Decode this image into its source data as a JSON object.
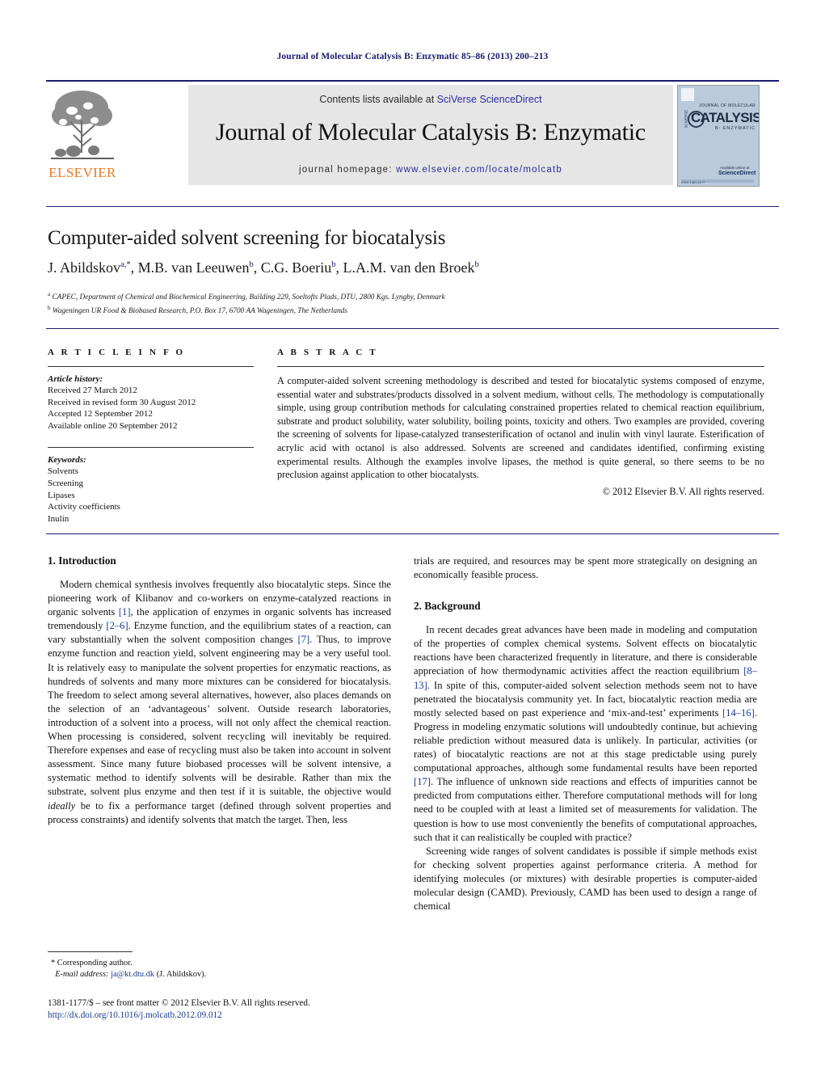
{
  "running_head": "Journal of Molecular Catalysis B: Enzymatic 85–86 (2013) 200–213",
  "masthead": {
    "publisher_name": "ELSEVIER",
    "contents_prefix": "Contents lists available at ",
    "contents_link": "SciVerse ScienceDirect",
    "journal_name": "Journal of Molecular Catalysis B: Enzymatic",
    "homepage_prefix": "journal homepage: ",
    "homepage_url": "www.elsevier.com/locate/molcatb",
    "cover": {
      "top_text": "JOURNAL OF MOLECULAR",
      "main_text": "CATALYSIS",
      "sub_text": "B: ENZYMATIC",
      "side_text": "SCIVERSE",
      "bottom_label": "Available online at",
      "bottom_brand": "ScienceDirect",
      "foot_text": "ISSN 1381-1177",
      "background_color": "#b9cadc"
    }
  },
  "article": {
    "title": "Computer-aided solvent screening for biocatalysis",
    "authors_html": "J. Abildskov<sup>a,*</sup>, M.B. van Leeuwen<sup>b</sup>, C.G. Boeriu<sup>b</sup>, L.A.M. van den Broek<sup>b</sup>",
    "affiliation_a": "CAPEC, Department of Chemical and Biochemical Engineering, Building 229, Soeltofts Plads, DTU, 2800 Kgs. Lyngby, Denmark",
    "affiliation_b": "Wageningen UR Food & Biobased Research, P.O. Box 17, 6700 AA Wageningen, The Netherlands"
  },
  "info": {
    "heading": "A R T I C L E    I N F O",
    "history_title": "Article history:",
    "history": [
      "Received 27 March 2012",
      "Received in revised form 30 August 2012",
      "Accepted 12 September 2012",
      "Available online 20 September 2012"
    ],
    "keywords_title": "Keywords:",
    "keywords": [
      "Solvents",
      "Screening",
      "Lipases",
      "Activity coefficients",
      "Inulin"
    ]
  },
  "abstract": {
    "heading": "A B S T R A C T",
    "text": "A computer-aided solvent screening methodology is described and tested for biocatalytic systems composed of enzyme, essential water and substrates/products dissolved in a solvent medium, without cells. The methodology is computationally simple, using group contribution methods for calculating constrained properties related to chemical reaction equilibrium, substrate and product solubility, water solubility, boiling points, toxicity and others. Two examples are provided, covering the screening of solvents for lipase-catalyzed transesterification of octanol and inulin with vinyl laurate. Esterification of acrylic acid with octanol is also addressed. Solvents are screened and candidates identified, confirming existing experimental results. Although the examples involve lipases, the method is quite general, so there seems to be no preclusion against application to other biocatalysts.",
    "copyright": "© 2012 Elsevier B.V. All rights reserved."
  },
  "sections": {
    "introduction_heading": "1.  Introduction",
    "background_heading": "2.  Background"
  },
  "body": {
    "intro_p1_html": "Modern chemical synthesis involves frequently also biocatalytic steps. Since the pioneering work of Klibanov and co-workers on enzyme-catalyzed reactions in organic solvents <span class=\"cite\">[1]</span>, the application of enzymes in organic solvents has increased tremendously <span class=\"cite\">[2–6]</span>. Enzyme function, and the equilibrium states of a reaction, can vary substantially when the solvent composition changes <span class=\"cite\">[7]</span>. Thus, to improve enzyme function and reaction yield, solvent engineering may be a very useful tool. It is relatively easy to manipulate the solvent properties for enzymatic reactions, as hundreds of solvents and many more mixtures can be considered for biocatalysis. The freedom to select among several alternatives, however, also places demands on the selection of an ‘advantageous’ solvent. Outside research laboratories, introduction of a solvent into a process, will not only affect the chemical reaction. When processing is considered, solvent recycling will inevitably be required. Therefore expenses and ease of recycling must also be taken into account in solvent assessment. Since many future biobased processes will be solvent intensive, a systematic method to identify solvents will be desirable. Rather than mix the substrate, solvent plus enzyme and then test if it is suitable, the objective would <span class=\"ital\">ideally</span> be to fix a performance target (defined through solvent properties and process constraints) and identify solvents that match the target. Then, less",
    "intro_cont_html": "trials are required, and resources may be spent more strategically on designing an economically feasible process.",
    "background_p1_html": "In recent decades great advances have been made in modeling and computation of the properties of complex chemical systems. Solvent effects on biocatalytic reactions have been characterized frequently in literature, and there is considerable appreciation of how thermodynamic activities affect the reaction equilibrium <span class=\"cite\">[8–13]</span>. In spite of this, computer-aided solvent selection methods seem not to have penetrated the biocatalysis community yet. In fact, biocatalytic reaction media are mostly selected based on past experience and ‘mix-and-test’ experiments <span class=\"cite\">[14–16]</span>. Progress in modeling enzymatic solutions will undoubtedly continue, but achieving reliable prediction without measured data is unlikely. In particular, activities (or rates) of biocatalytic reactions are not at this stage predictable using purely computational approaches, although some fundamental results have been reported <span class=\"cite\">[17]</span>. The influence of unknown side reactions and effects of impurities cannot be predicted from computations either. Therefore computational methods will for long need to be coupled with at least a limited set of measurements for validation. The question is how to use most conveniently the benefits of computational approaches, such that it can realistically be coupled with practice?",
    "background_p2_html": "Screening wide ranges of solvent candidates is possible if simple methods exist for checking solvent properties against performance criteria. A method for identifying molecules (or mixtures) with desirable properties is computer-aided molecular design (CAMD). Previously, CAMD has been used to design a range of chemical"
  },
  "footer": {
    "corresponding_marker": "*  Corresponding author.",
    "email_label": "E-mail address:",
    "email": "ja@kt.dtu.dk",
    "email_suffix": "(J. Abildskov).",
    "issn_line": "1381-1177/$ – see front matter © 2012 Elsevier B.V. All rights reserved.",
    "doi_line": "http://dx.doi.org/10.1016/j.molcatb.2012.09.012"
  }
}
